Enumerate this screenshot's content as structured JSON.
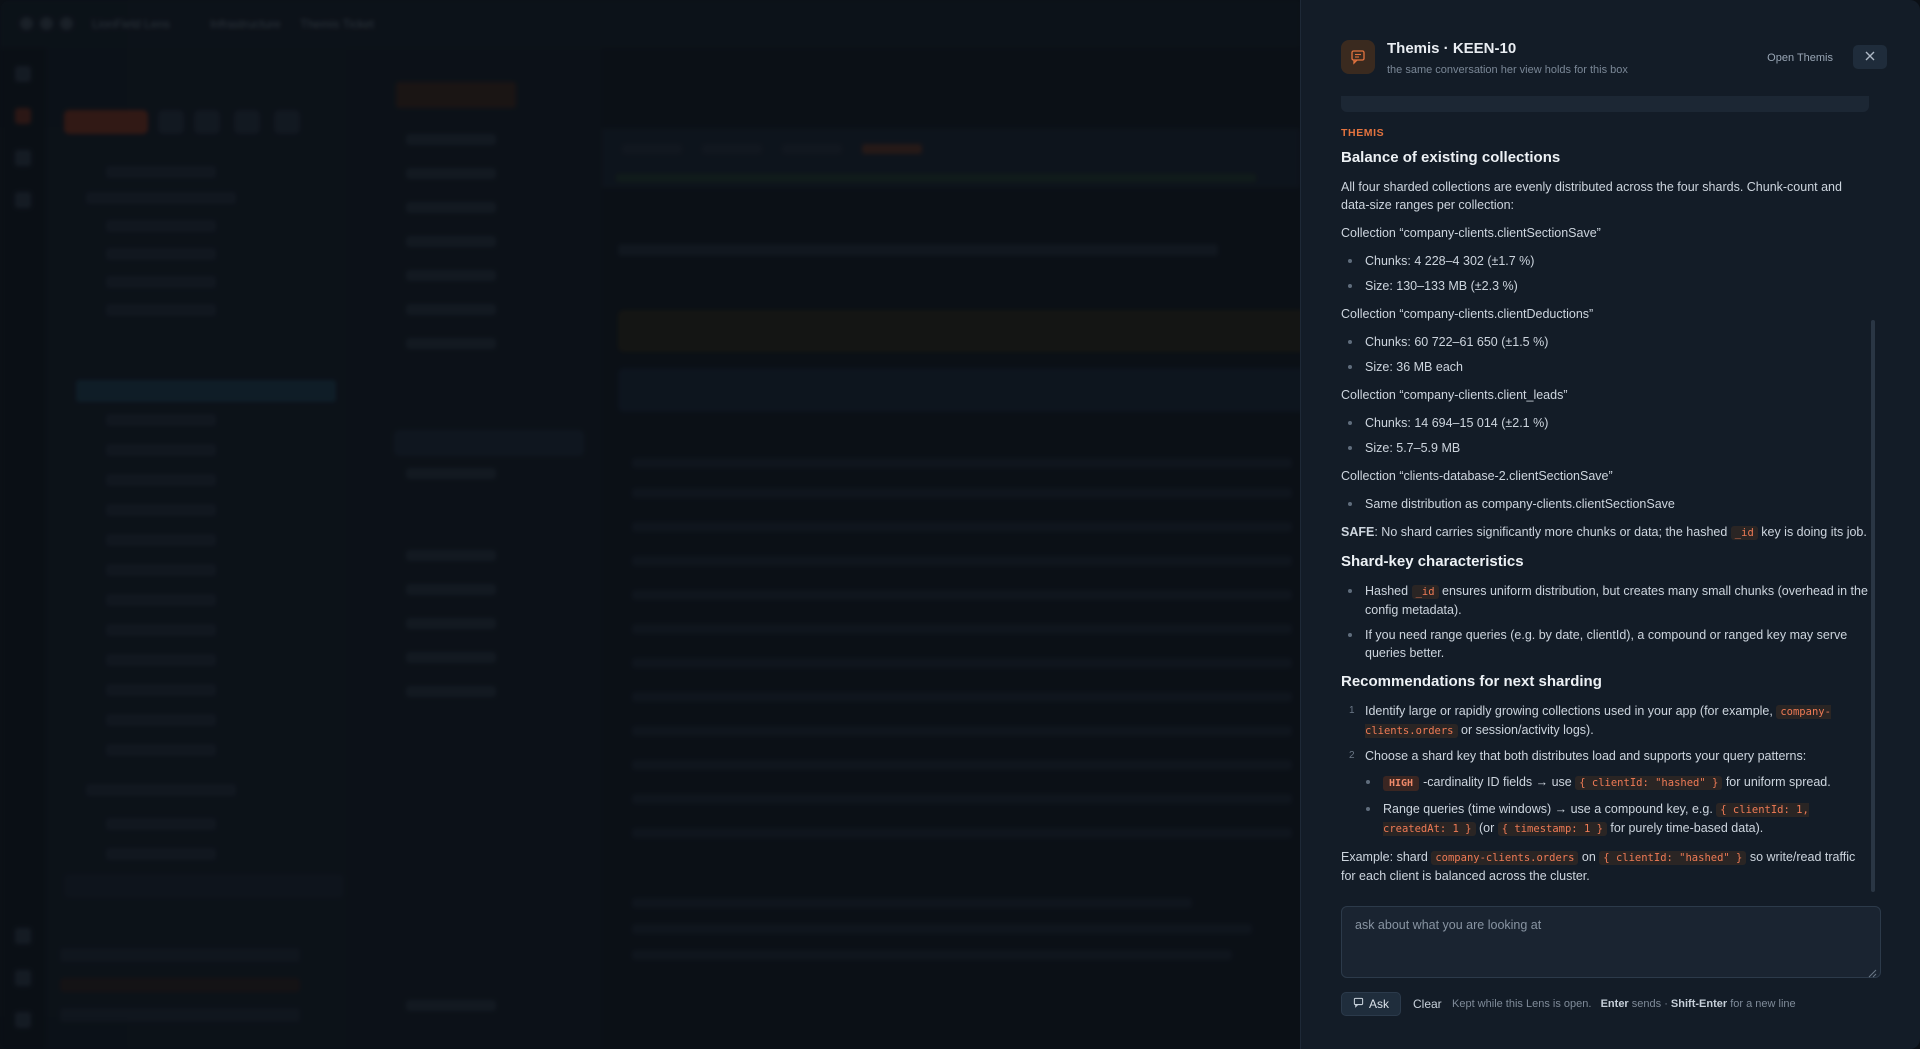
{
  "window": {
    "app_title": "LionField Lens",
    "crumb_1": "Infrastructure",
    "crumb_2": "Themis Ticket"
  },
  "lens": {
    "title": "Themis · KEEN-10",
    "subtitle": "the same conversation her view holds for this box",
    "open_label": "Open Themis",
    "close_icon": "close-icon",
    "avatar_icon": "chat-icon"
  },
  "message": {
    "kicker": "THEMIS",
    "h1": "Balance of existing collections",
    "intro": "All four sharded collections are evenly distributed across the four shards. Chunk-count and data-size ranges per collection:",
    "collections": [
      {
        "label": "Collection “company-clients.clientSectionSave”",
        "items": [
          "Chunks: 4 228–4 302 (±1.7 %)",
          "Size: 130–133 MB (±2.3 %)"
        ]
      },
      {
        "label": "Collection “company-clients.clientDeductions”",
        "items": [
          "Chunks: 60 722–61 650 (±1.5 %)",
          "Size: 36 MB each"
        ]
      },
      {
        "label": "Collection “company-clients.client_leads”",
        "items": [
          "Chunks: 14 694–15 014 (±2.1 %)",
          "Size: 5.7–5.9 MB"
        ]
      },
      {
        "label": "Collection “clients-database-2.clientSectionSave”",
        "items": [
          "Same distribution as company-clients.clientSectionSave"
        ]
      }
    ],
    "safe_label": "SAFE",
    "safe_text_a": ": No shard carries significantly more chunks or data; the hashed",
    "safe_code": "_id",
    "safe_text_b": "key is doing its job.",
    "h2": "Shard-key characteristics",
    "shard_b1_a": "Hashed",
    "shard_b1_code": "_id",
    "shard_b1_b": "ensures uniform distribution, but creates many small chunks (overhead in the config metadata).",
    "shard_b2": "If you need range queries (e.g. by date, clientId), a compound or ranged key may serve queries better.",
    "h3": "Recommendations for next sharding",
    "rec1_a": "Identify large or rapidly growing collections used in your app (for example,",
    "rec1_code": "company-clients.orders",
    "rec1_b": "or session/activity logs).",
    "rec2": "Choose a shard key that both distributes load and supports your query patterns:",
    "rec2_s1_badge": "HIGH",
    "rec2_s1_a": "-cardinality ID fields → use",
    "rec2_s1_code": "{ clientId: \"hashed\" }",
    "rec2_s1_b": "for uniform spread.",
    "rec2_s2_a": "Range queries (time windows) → use a compound key, e.g.",
    "rec2_s2_code1": "{ clientId: 1, createdAt: 1 }",
    "rec2_s2_b": "(or",
    "rec2_s2_code2": "{ timestamp: 1 }",
    "rec2_s2_c": "for purely time-based data).",
    "ex_a": "Example: shard",
    "ex_code1": "company-clients.orders",
    "ex_b": "on",
    "ex_code2": "{ clientId: \"hashed\" }",
    "ex_c": "so write/read traffic for each client is balanced across the cluster."
  },
  "composer": {
    "placeholder": "ask about what you are looking at",
    "ask_label": "Ask",
    "clear_label": "Clear",
    "hint_a": "Kept while this Lens is open.",
    "hint_enter": "Enter",
    "hint_b": "sends ·",
    "hint_shift": "Shift-Enter",
    "hint_c": "for a new line"
  },
  "colors": {
    "accent": "#e3733f",
    "panel_bg": "#131c27",
    "code_fg": "#ee7a55"
  }
}
